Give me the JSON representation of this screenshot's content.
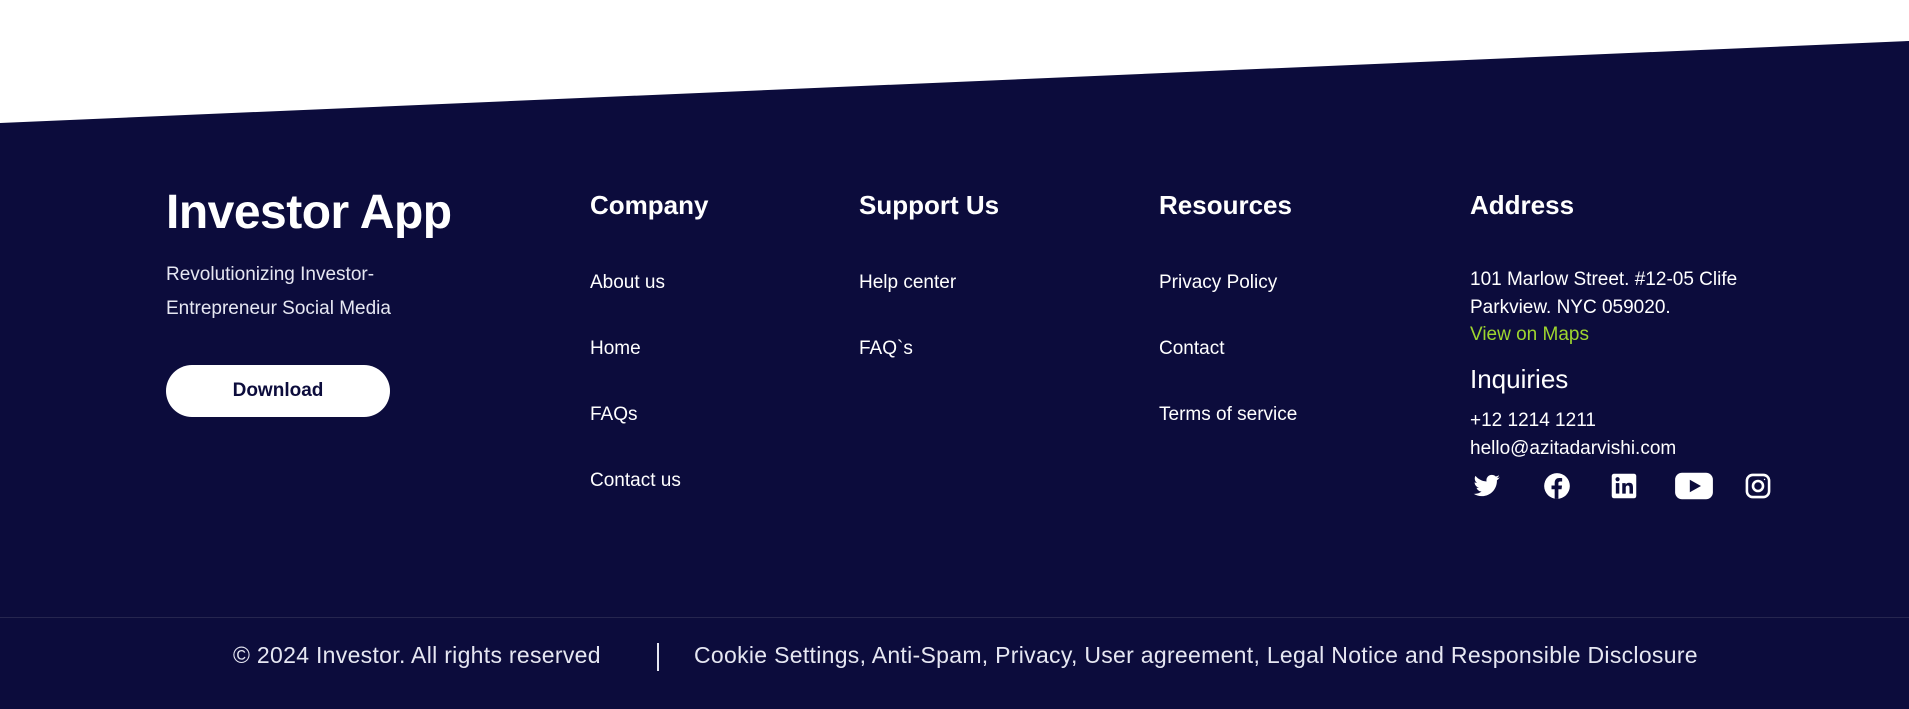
{
  "colors": {
    "background": "#0c0c3c",
    "accent_link": "#9ed52f",
    "text": "#ffffff",
    "button_bg": "#ffffff",
    "button_text": "#0c0c3c"
  },
  "brand": {
    "title": "Investor App",
    "tagline": "Revolutionizing Investor-Entrepreneur Social Media",
    "download_label": "Download"
  },
  "columns": {
    "company": {
      "heading": "Company",
      "links": [
        "About us",
        "Home",
        "FAQs",
        "Contact us"
      ]
    },
    "support": {
      "heading": "Support Us",
      "links": [
        "Help center",
        "FAQ`s"
      ]
    },
    "resources": {
      "heading": "Resources",
      "links": [
        "Privacy Policy",
        "Contact",
        "Terms of service"
      ]
    },
    "address": {
      "heading": "Address",
      "address_text": "101 Marlow Street. #12-05 Clife Parkview. NYC 059020.",
      "maps_link": "View on Maps",
      "inquiries_heading": "Inquiries",
      "phone": "+12 1214 1211",
      "email": "hello@azitadarvishi.com"
    }
  },
  "socials": [
    {
      "icon": "twitter-icon"
    },
    {
      "icon": "facebook-icon"
    },
    {
      "icon": "linkedin-icon"
    },
    {
      "icon": "youtube-icon"
    },
    {
      "icon": "instagram-icon"
    }
  ],
  "bottom_bar": {
    "copyright": "© 2024 Investor. All rights reserved",
    "legal_links": "Cookie Settings, Anti-Spam, Privacy, User agreement, Legal Notice and Responsible Disclosure"
  }
}
